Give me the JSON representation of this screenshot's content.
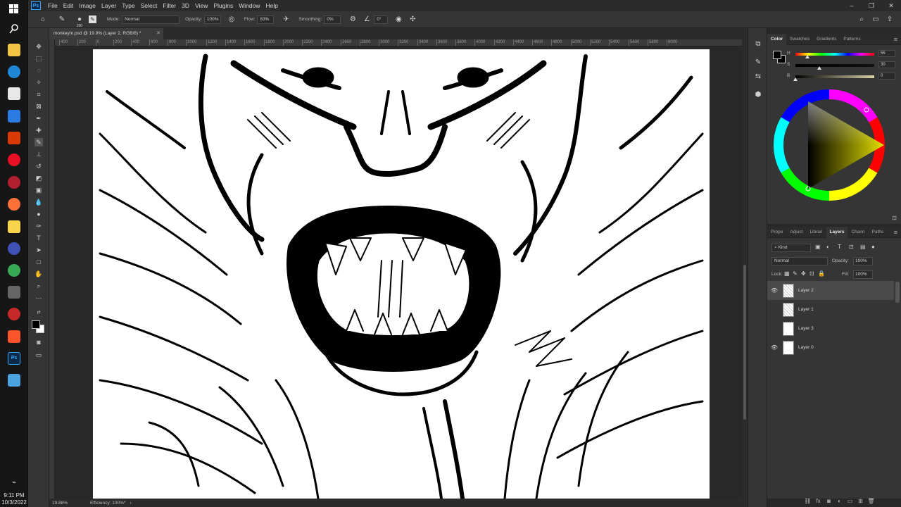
{
  "menubar": {
    "items": [
      "File",
      "Edit",
      "Image",
      "Layer",
      "Type",
      "Select",
      "Filter",
      "3D",
      "View",
      "Plugins",
      "Window",
      "Help"
    ]
  },
  "options": {
    "brush_size": "200",
    "mode_label": "Mode:",
    "mode_value": "Normal",
    "opacity_label": "Opacity:",
    "opacity_value": "100%",
    "flow_label": "Flow:",
    "flow_value": "83%",
    "smoothing_label": "Smoothing:",
    "smoothing_value": "0%",
    "angle_value": "0°"
  },
  "document": {
    "tab_title": "monkeyIn.psd @ 19.9% (Layer 2, RGB/8) *"
  },
  "ruler": {
    "ticks": [
      "400",
      "200",
      "0",
      "200",
      "400",
      "600",
      "800",
      "1000",
      "1200",
      "1400",
      "1600",
      "1800",
      "2000",
      "2200",
      "2400",
      "2600",
      "2800",
      "3000",
      "3200",
      "3400",
      "3600",
      "3800",
      "4000",
      "4200",
      "4400",
      "4600",
      "4800",
      "5000",
      "5200",
      "5400",
      "5600",
      "5800",
      "6000"
    ]
  },
  "status": {
    "zoom": "19.88%",
    "info": "Efficiency: 100%*"
  },
  "color_panel": {
    "tabs": [
      "Color",
      "Swatches",
      "Gradients",
      "Patterns"
    ],
    "h_label": "H",
    "s_label": "S",
    "b_label": "B",
    "h_value": "55",
    "s_value": "30",
    "b_value": "0",
    "h_level": 0.15,
    "s_level": 0.3,
    "b_level": 0.0
  },
  "layers_panel": {
    "tabs": [
      "Prope",
      "Adjust",
      "Librari",
      "Layers",
      "Chann",
      "Paths"
    ],
    "kind_label": "Kind",
    "blend_mode": "Normal",
    "opacity_label": "Opacity:",
    "opacity_value": "100%",
    "lock_label": "Lock:",
    "fill_label": "Fill:",
    "fill_value": "100%",
    "layers": [
      {
        "name": "Layer 2",
        "visible": true,
        "selected": true
      },
      {
        "name": "Layer 1",
        "visible": false,
        "selected": false
      },
      {
        "name": "Layer 3",
        "visible": false,
        "selected": false
      },
      {
        "name": "Layer 0",
        "visible": true,
        "selected": false
      }
    ]
  },
  "clock": {
    "time": "9:11 PM",
    "date": "10/3/2022"
  }
}
